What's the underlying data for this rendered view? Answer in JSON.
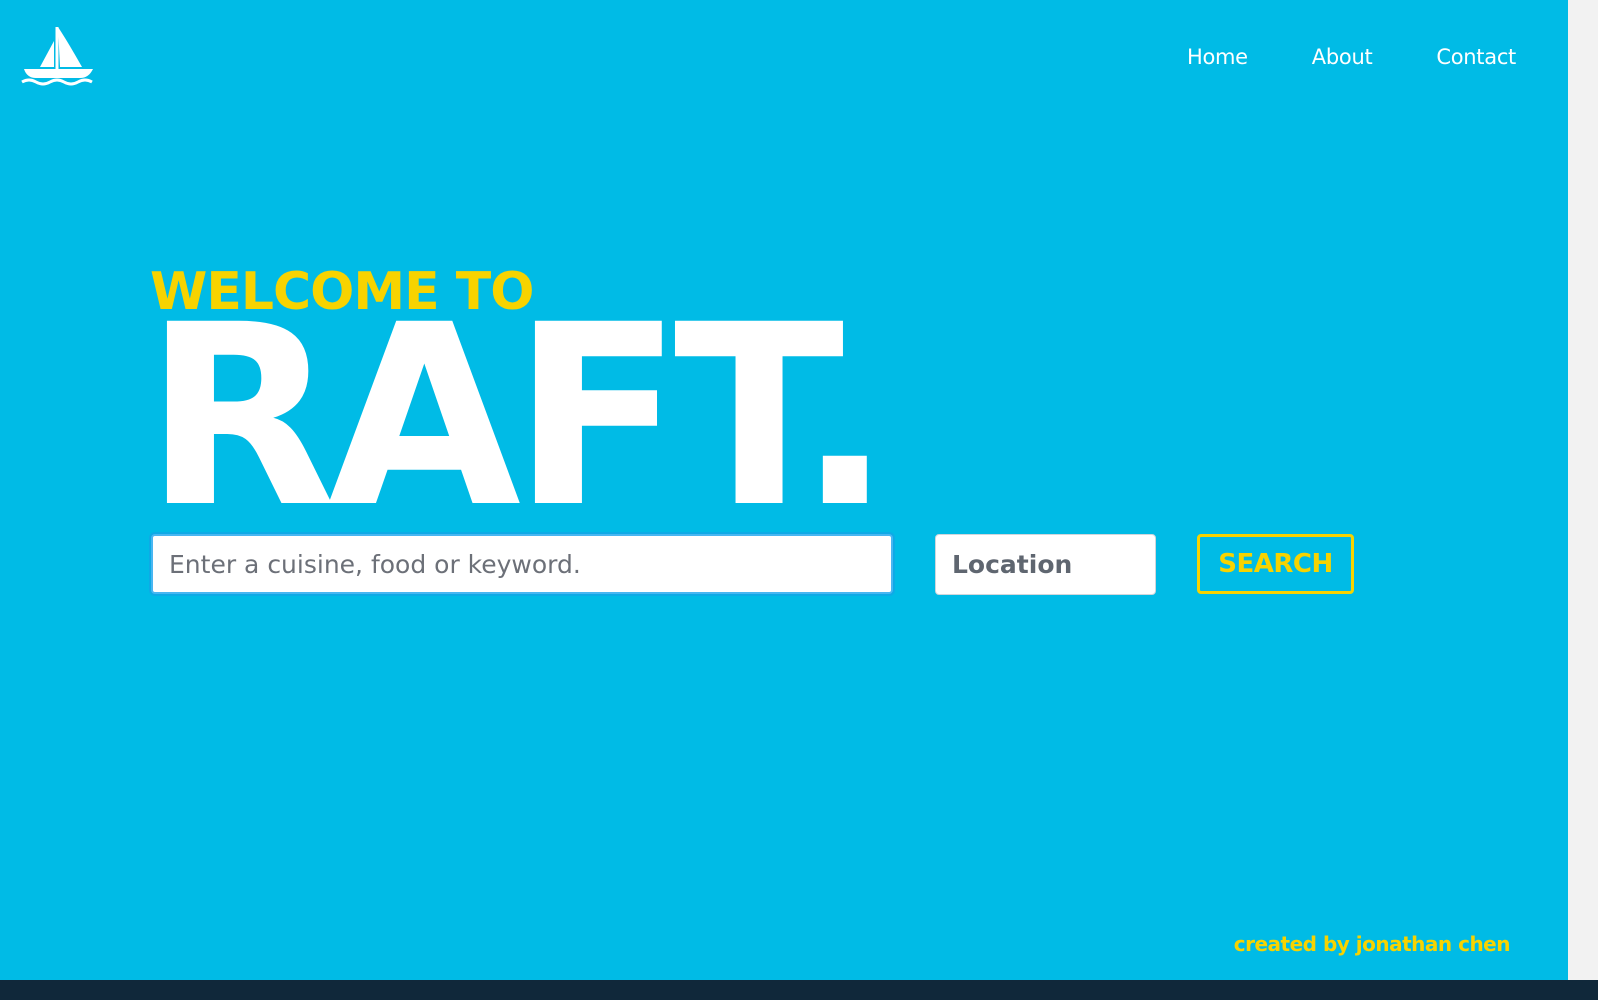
{
  "colors": {
    "background": "#00bbe6",
    "accent_yellow": "#f7d300",
    "white": "#ffffff"
  },
  "logo": {
    "icon": "sailboat-icon"
  },
  "nav": {
    "items": [
      {
        "label": "Home"
      },
      {
        "label": "About"
      },
      {
        "label": "Contact"
      }
    ]
  },
  "hero": {
    "welcome": "WELCOME TO",
    "brand": "RAFT."
  },
  "search": {
    "keyword_placeholder": "Enter a cuisine, food or keyword.",
    "keyword_value": "",
    "location_placeholder": "Location",
    "location_value": "",
    "button_label": "SEARCH"
  },
  "footer": {
    "credit": "created by jonathan chen"
  }
}
